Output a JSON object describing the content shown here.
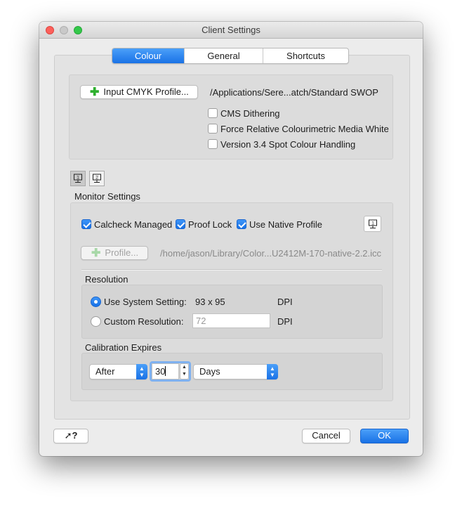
{
  "window": {
    "title": "Client Settings"
  },
  "tabs": [
    {
      "label": "Colour",
      "active": true
    },
    {
      "label": "General",
      "active": false
    },
    {
      "label": "Shortcuts",
      "active": false
    }
  ],
  "cmyk": {
    "button_label": "Input CMYK Profile...",
    "profile_path": "/Applications/Sere...atch/Standard SWOP",
    "options": [
      {
        "label": "CMS Dithering",
        "checked": false
      },
      {
        "label": "Force Relative Colourimetric Media White",
        "checked": false
      },
      {
        "label": "Version 3.4 Spot Colour Handling",
        "checked": false
      }
    ]
  },
  "monitor_tabs": [
    {
      "number": "1",
      "selected": true
    },
    {
      "number": "2",
      "selected": false
    }
  ],
  "monitor": {
    "heading": "Monitor Settings",
    "options": [
      {
        "label": "Calcheck Managed",
        "checked": true
      },
      {
        "label": "Proof Lock",
        "checked": true
      },
      {
        "label": "Use Native Profile",
        "checked": true
      }
    ],
    "profile_button": "Profile...",
    "profile_path": "/home/jason/Library/Color...U2412M-170-native-2.2.icc"
  },
  "resolution": {
    "heading": "Resolution",
    "system_label": "Use System Setting:",
    "system_value": "93 x 95",
    "custom_label": "Custom Resolution:",
    "custom_value": "72",
    "unit": "DPI",
    "selected": "system"
  },
  "calibration": {
    "heading": "Calibration Expires",
    "mode": "After",
    "amount": "30",
    "unit": "Days"
  },
  "footer": {
    "help_label": "?",
    "cancel_label": "Cancel",
    "ok_label": "OK"
  },
  "colors": {
    "accent": "#1a72e6",
    "window_bg": "#ececec"
  }
}
